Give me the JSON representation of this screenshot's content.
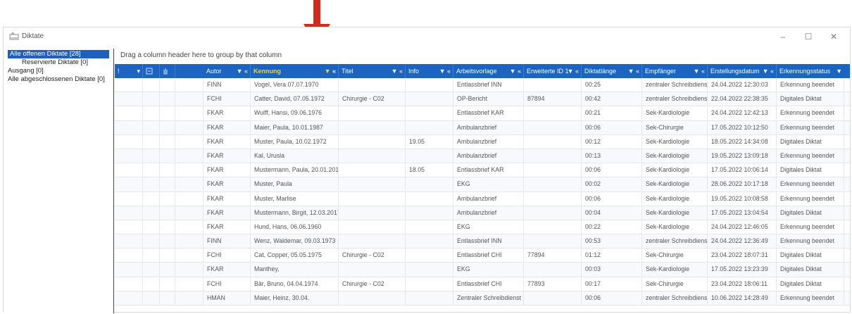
{
  "window": {
    "title": "Diktate",
    "minimize": "–",
    "maximize": "☐",
    "close": "✕"
  },
  "tree": {
    "items": [
      {
        "label": "Alle offenen Diktate  [28]",
        "selected": true
      },
      {
        "label": "Reservierte Diktate  [0]",
        "indent": true
      },
      {
        "label": "Ausgang  [0]"
      },
      {
        "label": "Alle abgeschlossenen Diktate  [0]"
      }
    ]
  },
  "group_bar": "Drag a column header here to group by that column",
  "columns": [
    {
      "label": "!",
      "filter": "▾"
    },
    {
      "label": "",
      "icon": "document-icon"
    },
    {
      "label": ""
    },
    {
      "label": "Autor"
    },
    {
      "label": "Kennung"
    },
    {
      "label": "Titel"
    },
    {
      "label": "Info"
    },
    {
      "label": "Arbeitsvorlage"
    },
    {
      "label": "Erweiterte ID 1"
    },
    {
      "label": "Diktatlänge"
    },
    {
      "label": "Empfänger"
    },
    {
      "label": "Erstellungsdatum"
    },
    {
      "label": "Erkennungsstatus"
    }
  ],
  "rows": [
    [
      "FINN",
      "Vogel, Vera 07.07.1970",
      "",
      "",
      "Entlassbrief INN",
      "",
      "00:25",
      "zentraler Schreibdienst",
      "24.04.2022 12:30:03",
      "Erkennung beendet"
    ],
    [
      "FCHI",
      "Catter, David, 07.05.1972",
      "Chirurgie - C02",
      "",
      "OP-Bericht",
      "87894",
      "00:42",
      "zentraler Schreibdienst",
      "22.04.2022 22:38:35",
      "Digitales Diktat"
    ],
    [
      "FKAR",
      "Wulff, Hansi, 09.06.1976",
      "",
      "",
      "Entlassbrief KAR",
      "",
      "00:21",
      "Sek-Kardiologie",
      "24.04.2022 12:42:13",
      "Erkennung beendet"
    ],
    [
      "FKAR",
      "Maier, Paula, 10.01.1987",
      "",
      "",
      "Ambulanzbrief",
      "",
      "00:06",
      "Sek-Chirurgie",
      "17.05.2022 10:12:50",
      "Erkennung beendet"
    ],
    [
      "FKAR",
      "Muster, Paula, 10.02.1972",
      "",
      "19.05",
      "Ambulanzbrief",
      "",
      "00:12",
      "Sek-Kardiologie",
      "18.05.2022 14:34:08",
      "Digitales Diktat"
    ],
    [
      "FKAR",
      "Kal, Urusla",
      "",
      "",
      "Ambulanzbrief",
      "",
      "00:13",
      "Sek-Kardiologie",
      "19.05.2022 13:09:18",
      "Erkennung beendet"
    ],
    [
      "FKAR",
      "Mustermann, Paula, 20.01.2014",
      "",
      "18.05",
      "Entlassbrief KAR",
      "",
      "00:06",
      "Sek-Kardiologie",
      "17.05.2022 10:06:14",
      "Digitales Diktat"
    ],
    [
      "FKAR",
      "Muster, Paula",
      "",
      "",
      "EKG",
      "",
      "00:02",
      "Sek-Kardiologie",
      "28.06.2022 10:17:18",
      "Erkennung beendet"
    ],
    [
      "FKAR",
      "Muster, Marlise",
      "",
      "",
      "Ambulanzbrief",
      "",
      "00:06",
      "Sek-Kardiologie",
      "19.05.2022 10:08:58",
      "Erkennung beendet"
    ],
    [
      "FKAR",
      "Mustermann, Birgit, 12.03.2017",
      "",
      "",
      "Ambulanzbrief",
      "",
      "00:04",
      "Sek-Kardiologie",
      "17.05.2022 13:04:54",
      "Digitales Diktat"
    ],
    [
      "FKAR",
      "Hund, Hans, 06.06.1960",
      "",
      "",
      "EKG",
      "",
      "00:22",
      "Sek-Kardiologie",
      "24.04.2022 12:46:05",
      "Erkennung beendet"
    ],
    [
      "FINN",
      "Wenz, Waldemar, 09.03.1973",
      "",
      "",
      "Entlassbrief INN",
      "",
      "00:53",
      "zentraler Schreibdienst",
      "24.04.2022 12:36:49",
      "Erkennung beendet"
    ],
    [
      "FCHI",
      "Cat, Copper, 05.05.1975",
      "Chirurgie - C02",
      "",
      "Entlassbrief CHI",
      "77894",
      "01:12",
      "Sek-Chirurgie",
      "23.04.2022 18:07:31",
      "Digitales Diktat"
    ],
    [
      "FKAR",
      "Manthey,",
      "",
      "",
      "EKG",
      "",
      "00:03",
      "Sek-Kardiologie",
      "17.05.2022 13:23:39",
      "Digitales Diktat"
    ],
    [
      "FCHI",
      "Bär, Bruno, 04.04.1974",
      "Chirurgie - C02",
      "",
      "Entlassbrief CHI",
      "77893",
      "00:17",
      "Sek-Chirurgie",
      "23.04.2022 18:06:11",
      "Digitales Diktat"
    ],
    [
      "HMAN",
      "Maier, Heinz, 30.04.",
      "",
      "",
      "Zentraler Schreibdienst",
      "",
      "00:06",
      "zentraler Schreibdienst",
      "10.06.2022 14:28:49",
      "Erkennung beendet"
    ]
  ],
  "colors": {
    "header_bg": "#1d63c2",
    "sort_highlight": "#ffd400",
    "arrow": "#d42a1e"
  }
}
